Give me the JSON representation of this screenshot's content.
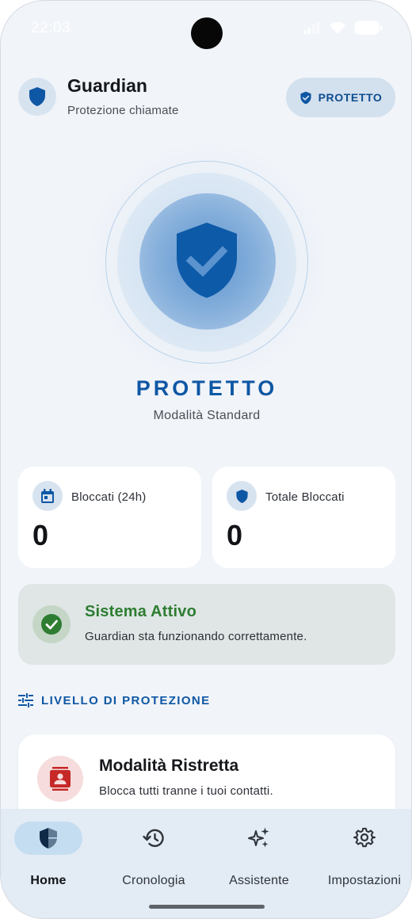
{
  "status_bar": {
    "time": "22:03",
    "icons": [
      "signal-icon",
      "wifi-icon",
      "battery-icon"
    ]
  },
  "header": {
    "title": "Guardian",
    "subtitle": "Protezione chiamate",
    "status_chip": "PROTETTO",
    "icon": "shield-icon"
  },
  "hero": {
    "status": "PROTETTO",
    "mode": "Modalità Standard",
    "icon": "shield-check-icon"
  },
  "stats": [
    {
      "label": "Bloccati (24h)",
      "value": "0",
      "icon": "calendar-icon"
    },
    {
      "label": "Totale Bloccati",
      "value": "0",
      "icon": "shield-icon"
    }
  ],
  "system": {
    "title": "Sistema Attivo",
    "description": "Guardian sta funzionando correttamente.",
    "icon": "check-circle-icon"
  },
  "section": {
    "title": "LIVELLO DI PROTEZIONE",
    "icon": "tune-icon"
  },
  "mode_card": {
    "title": "Modalità Ristretta",
    "description": "Blocca tutti tranne i tuoi contatti.",
    "icon": "contacts-icon"
  },
  "nav": {
    "items": [
      {
        "label": "Home",
        "icon": "shield-home-icon",
        "active": true
      },
      {
        "label": "Cronologia",
        "icon": "history-icon",
        "active": false
      },
      {
        "label": "Assistente",
        "icon": "sparkles-icon",
        "active": false
      },
      {
        "label": "Impostazioni",
        "icon": "gear-icon",
        "active": false
      }
    ]
  },
  "colors": {
    "primary": "#0e57a4",
    "success": "#2e7d32",
    "danger": "#c62828",
    "background": "#f1f4f9"
  }
}
